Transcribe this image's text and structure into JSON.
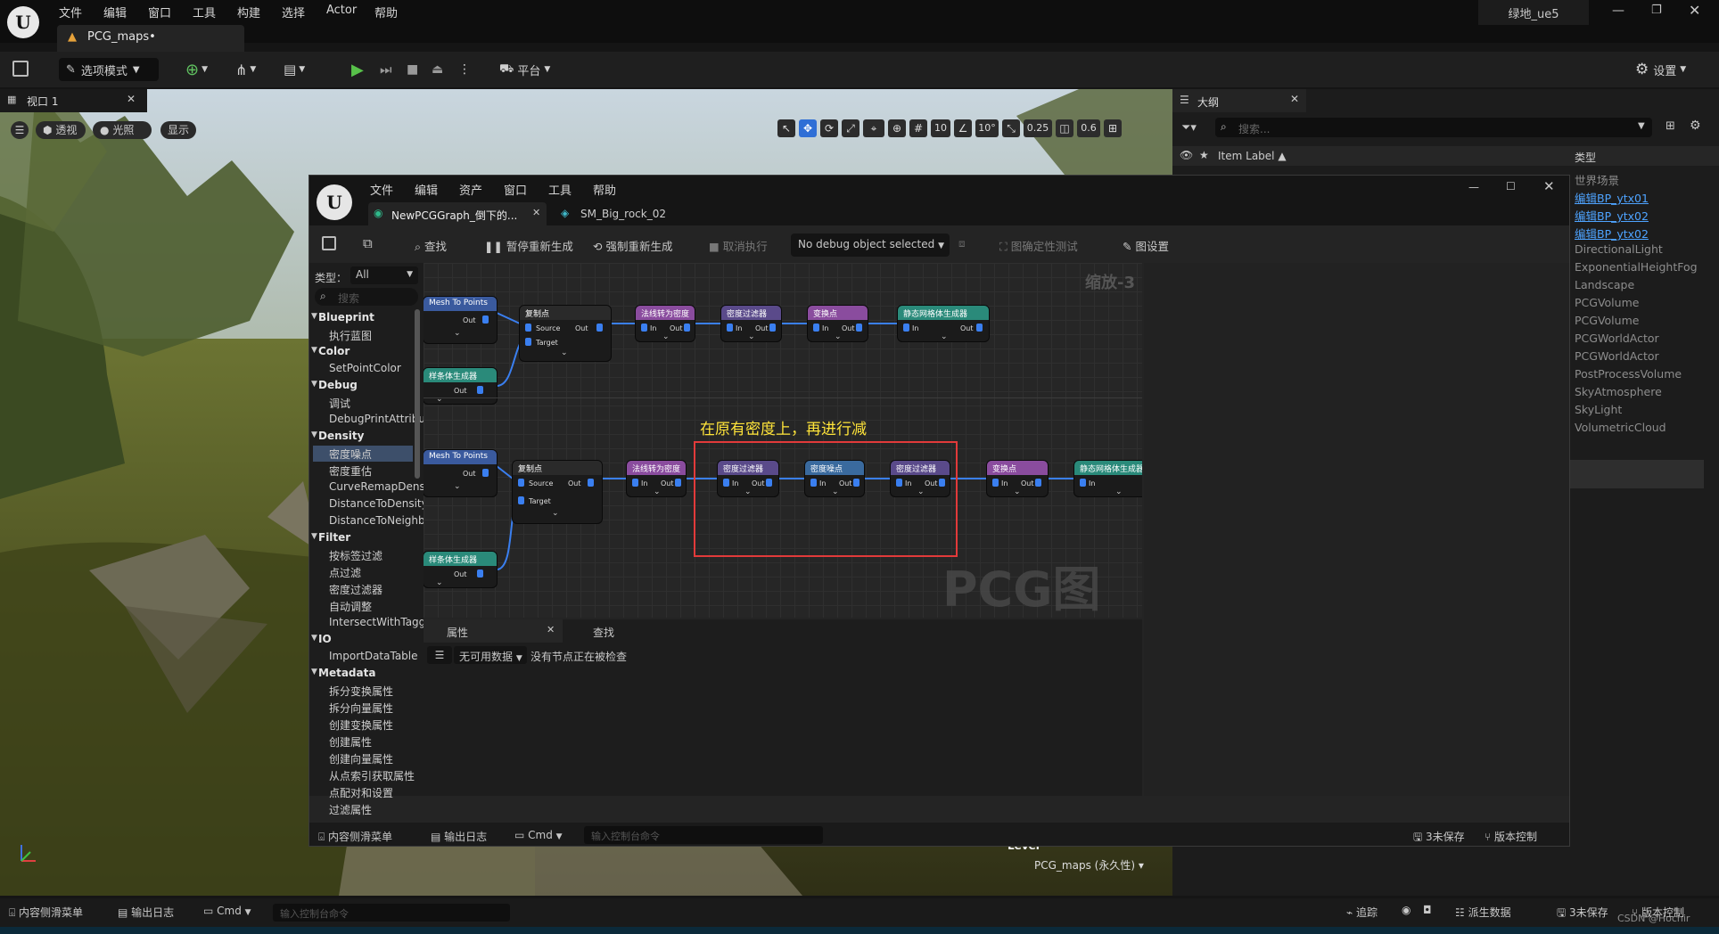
{
  "main_menu": [
    "文件",
    "编辑",
    "窗口",
    "工具",
    "构建",
    "选择",
    "Actor",
    "帮助"
  ],
  "project_name": "绿地_ue5",
  "map_tab": "PCG_maps•",
  "toolbar": {
    "mode_label": "选项模式",
    "platform_label": "平台",
    "settings_label": "设置"
  },
  "viewport": {
    "tab_label": "视口 1",
    "perspective": "透视",
    "lighting": "光照",
    "show": "显示",
    "grid_snap": "10",
    "rot_snap": "10°",
    "scale_snap": "0.25",
    "cam_speed": "0.6",
    "level_label": "Level",
    "level_value": "PCG_maps (永久性)"
  },
  "outliner": {
    "title": "大纲",
    "search_placeholder": "搜索...",
    "col_label": "Item Label ▲",
    "col_type": "类型",
    "types": [
      "世界场景",
      "编辑BP_ytx01",
      "编辑BP_ytx02",
      "编辑BP_ytx02",
      "DirectionalLight",
      "ExponentialHeightFog",
      "Landscape",
      "PCGVolume",
      "PCGVolume",
      "PCGWorldActor",
      "PCGWorldActor",
      "PostProcessVolume",
      "SkyAtmosphere",
      "SkyLight",
      "VolumetricCloud"
    ]
  },
  "pcg": {
    "menu": [
      "文件",
      "编辑",
      "资产",
      "窗口",
      "工具",
      "帮助"
    ],
    "tab1": "NewPCGGraph_倒下的...",
    "tab2": "SM_Big_rock_02",
    "tb_find": "查找",
    "tb_pause": "暂停重新生成",
    "tb_force": "强制重新生成",
    "tb_cancel": "取消执行",
    "tb_debug": "No debug object selected",
    "tb_determinism": "图确定性测试",
    "tb_graph_settings": "图设置",
    "type_label": "类型：",
    "type_value": "All",
    "search_placeholder": "搜索",
    "library": [
      {
        "kind": "cat",
        "text": "Blueprint"
      },
      {
        "kind": "item",
        "text": "执行蓝图"
      },
      {
        "kind": "cat",
        "text": "Color"
      },
      {
        "kind": "item",
        "text": "SetPointColor"
      },
      {
        "kind": "cat",
        "text": "Debug"
      },
      {
        "kind": "item",
        "text": "调试"
      },
      {
        "kind": "item",
        "text": "DebugPrintAttribute"
      },
      {
        "kind": "cat",
        "text": "Density"
      },
      {
        "kind": "item",
        "text": "密度噪点",
        "selected": true
      },
      {
        "kind": "item",
        "text": "密度重估"
      },
      {
        "kind": "item",
        "text": "CurveRemapDensity"
      },
      {
        "kind": "item",
        "text": "DistanceToDensity"
      },
      {
        "kind": "item",
        "text": "DistanceToNeighbor"
      },
      {
        "kind": "cat",
        "text": "Filter"
      },
      {
        "kind": "item",
        "text": "按标签过滤"
      },
      {
        "kind": "item",
        "text": "点过滤"
      },
      {
        "kind": "item",
        "text": "密度过滤器"
      },
      {
        "kind": "item",
        "text": "自动调整"
      },
      {
        "kind": "item",
        "text": "IntersectWithTagge"
      },
      {
        "kind": "cat",
        "text": "IO"
      },
      {
        "kind": "item",
        "text": "ImportDataTable"
      },
      {
        "kind": "cat",
        "text": "Metadata"
      },
      {
        "kind": "item",
        "text": "拆分变换属性"
      },
      {
        "kind": "item",
        "text": "拆分向量属性"
      },
      {
        "kind": "item",
        "text": "创建变换属性"
      },
      {
        "kind": "item",
        "text": "创建属性"
      },
      {
        "kind": "item",
        "text": "创建向量属性"
      },
      {
        "kind": "item",
        "text": "从点索引获取属性"
      },
      {
        "kind": "item",
        "text": "点配对和设置"
      },
      {
        "kind": "item",
        "text": "过滤属性"
      }
    ],
    "zoom": "缩放-3",
    "watermark": "PCG图表",
    "annotation": "在原有密度上，再进行减",
    "nodes": {
      "mesh_to_points": "Mesh To Points",
      "copy_points": "复制点",
      "surface_sampler": "法线转为密度",
      "density_filter": "密度过滤器",
      "density_noise": "密度噪点",
      "transform": "变换点",
      "static_mesh_spawner": "静态网格体生成器",
      "spline_sampler": "样条体生成器",
      "source": "Source",
      "target": "Target",
      "in": "In",
      "out": "Out"
    },
    "details_tab": "属性",
    "find_tab": "查找",
    "no_data": "无可用数据",
    "no_node": "没有节点正在被检查",
    "bottom": {
      "content_drawer": "内容侧滑菜单",
      "output_log": "输出日志",
      "cmd": "Cmd",
      "cmd_placeholder": "输入控制台命令",
      "unsaved": "3未保存",
      "source_control": "版本控制"
    }
  },
  "statusbar": {
    "content_drawer": "内容侧滑菜单",
    "output_log": "输出日志",
    "cmd": "Cmd",
    "cmd_placeholder": "输入控制台命令",
    "trace": "追踪",
    "derived_data": "派生数据",
    "unsaved": "3未保存",
    "source_control": "版本控制",
    "watermark": "CSDN @Hochir"
  }
}
